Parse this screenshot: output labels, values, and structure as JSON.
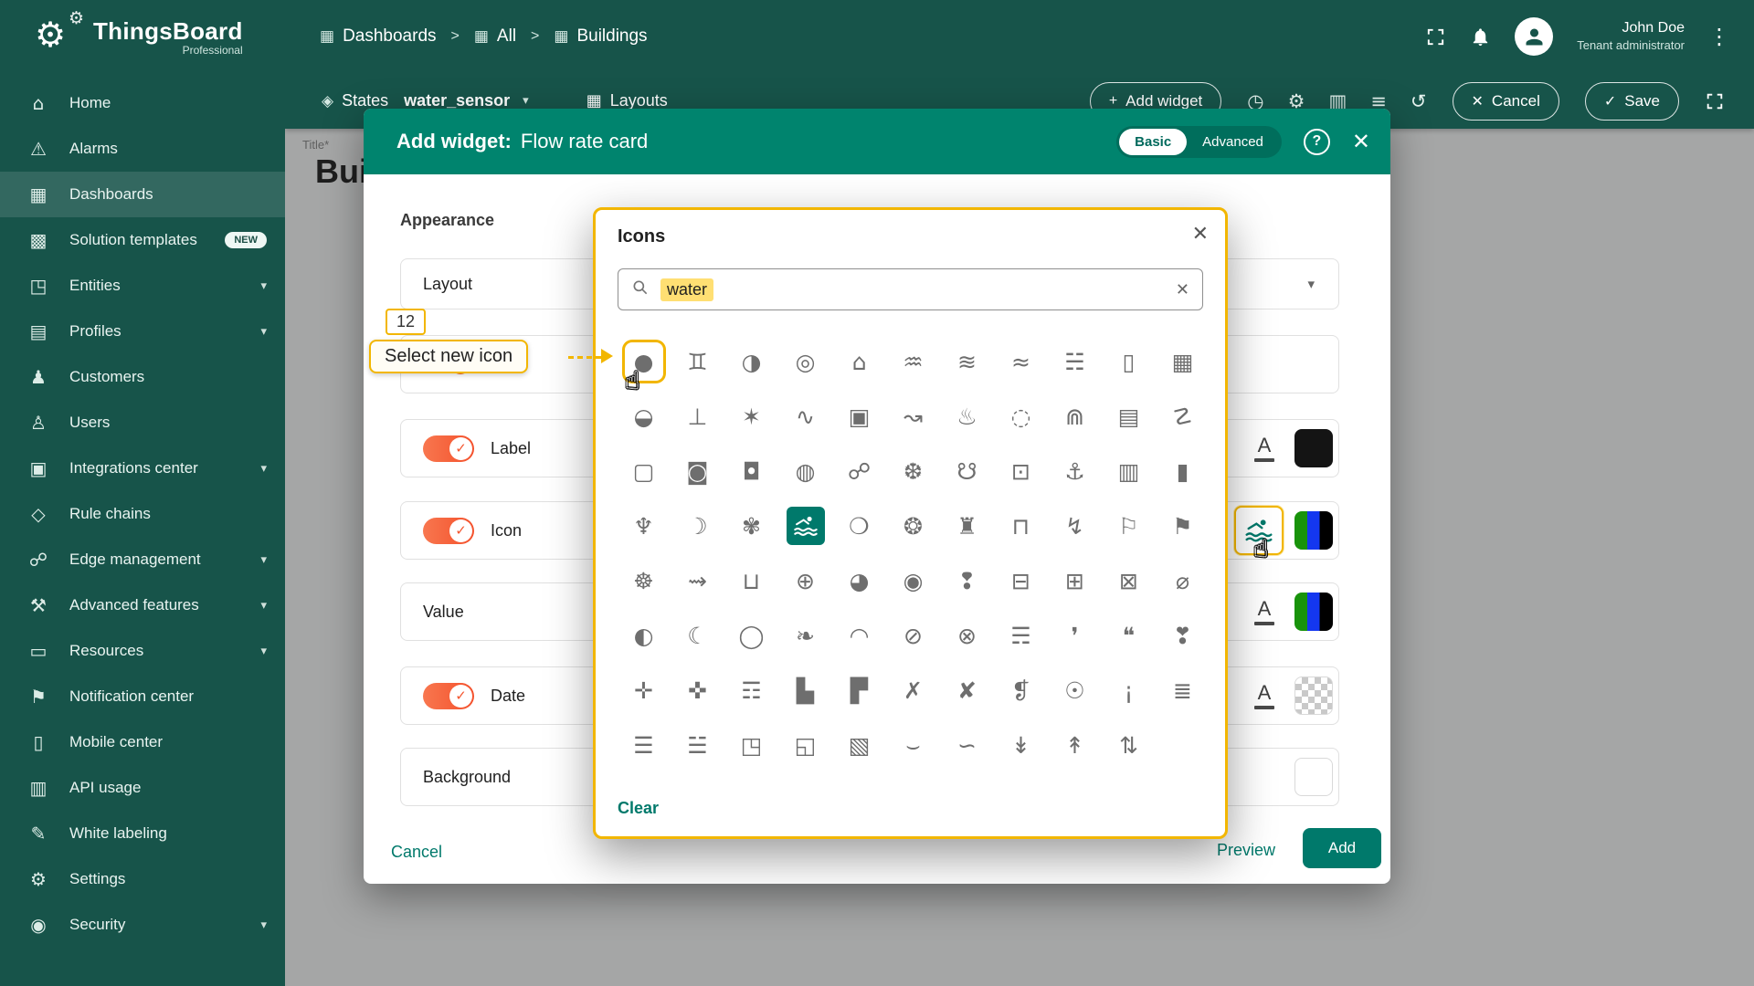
{
  "glyphs": {
    "chevron": "▾",
    "kebab": "⋮",
    "close": "✕",
    "check": "✓",
    "plus": "+",
    "separator": ">",
    "help": "?"
  },
  "colors": {
    "header": "#17544a",
    "modal_header": "#00846e",
    "accent_teal": "#00796b",
    "toggle_orange": "#f4562f",
    "annotation_amber": "#f2b600",
    "swatch_orange": "#f2682a",
    "label_swatch": "#141414"
  },
  "brand": {
    "name": "ThingsBoard",
    "sub": "Professional"
  },
  "header": {
    "breadcrumbs": [
      {
        "icon": "▦",
        "label": "Dashboards"
      },
      {
        "icon": "▦",
        "label": "All"
      },
      {
        "icon": "▦",
        "label": "Buildings"
      }
    ],
    "user": {
      "name": "John Doe",
      "role": "Tenant administrator"
    }
  },
  "sidebar": {
    "items": [
      {
        "label": "Home",
        "icon": "home-icon",
        "glyph": "⌂"
      },
      {
        "label": "Alarms",
        "icon": "alarms-icon",
        "glyph": "⚠"
      },
      {
        "label": "Dashboards",
        "icon": "dashboards-icon",
        "glyph": "▦",
        "active": true
      },
      {
        "label": "Solution templates",
        "icon": "solution-templates-icon",
        "glyph": "▩",
        "badge": "NEW"
      },
      {
        "label": "Entities",
        "icon": "entities-icon",
        "glyph": "◳",
        "chevron": true
      },
      {
        "label": "Profiles",
        "icon": "profiles-icon",
        "glyph": "▤",
        "chevron": true
      },
      {
        "label": "Customers",
        "icon": "customers-icon",
        "glyph": "♟"
      },
      {
        "label": "Users",
        "icon": "users-icon",
        "glyph": "♙"
      },
      {
        "label": "Integrations center",
        "icon": "integrations-icon",
        "glyph": "▣",
        "chevron": true
      },
      {
        "label": "Rule chains",
        "icon": "rule-chains-icon",
        "glyph": "◇"
      },
      {
        "label": "Edge management",
        "icon": "edge-management-icon",
        "glyph": "☍",
        "chevron": true
      },
      {
        "label": "Advanced features",
        "icon": "advanced-features-icon",
        "glyph": "⚒",
        "chevron": true
      },
      {
        "label": "Resources",
        "icon": "resources-icon",
        "glyph": "▭",
        "chevron": true
      },
      {
        "label": "Notification center",
        "icon": "notification-center-icon",
        "glyph": "⚑"
      },
      {
        "label": "Mobile center",
        "icon": "mobile-center-icon",
        "glyph": "▯"
      },
      {
        "label": "API usage",
        "icon": "api-usage-icon",
        "glyph": "▥"
      },
      {
        "label": "White labeling",
        "icon": "white-labeling-icon",
        "glyph": "✎"
      },
      {
        "label": "Settings",
        "icon": "settings-icon",
        "glyph": "⚙"
      },
      {
        "label": "Security",
        "icon": "security-icon",
        "glyph": "◉",
        "chevron": true
      }
    ]
  },
  "toolbar": {
    "states_icon": "◈",
    "states_label": "States",
    "state_value": "water_sensor",
    "layouts_icon": "▦",
    "layouts_label": "Layouts",
    "add_widget_label": "Add widget",
    "icon_buttons": [
      {
        "n": "time-window-icon",
        "g": "◷"
      },
      {
        "n": "dashboard-settings-icon",
        "g": "⚙"
      },
      {
        "n": "entity-aliases-icon",
        "g": "▥"
      },
      {
        "n": "filters-icon",
        "g": "≡"
      },
      {
        "n": "version-history-icon",
        "g": "↺"
      }
    ],
    "cancel_label": "Cancel",
    "save_label": "Save"
  },
  "content": {
    "title_label": "Title*",
    "title_value": "Bui"
  },
  "modal": {
    "title_prefix": "Add widget:",
    "title_name": "Flow rate card",
    "basic_label": "Basic",
    "advanced_label": "Advanced",
    "appearance_label": "Appearance",
    "fields": {
      "layout": "Layout",
      "label": "Label",
      "icon": "Icon",
      "value": "Value",
      "date": "Date",
      "background": "Background"
    },
    "cancel_label": "Cancel",
    "preview_label": "Preview",
    "add_label": "Add"
  },
  "icons_dialog": {
    "title": "Icons",
    "search_value": "water",
    "clear_label": "Clear",
    "selected_index": 36,
    "grid": [
      {
        "n": "water-drop",
        "g": "●"
      },
      {
        "n": "water-access",
        "g": "♊"
      },
      {
        "n": "water-contrast",
        "g": "◑"
      },
      {
        "n": "water-opacity",
        "g": "◎"
      },
      {
        "n": "water-fountain",
        "g": "⌂"
      },
      {
        "n": "tsunami",
        "g": "♒"
      },
      {
        "n": "waves",
        "g": "≋"
      },
      {
        "n": "water",
        "g": "≈"
      },
      {
        "n": "flood",
        "g": "☵"
      },
      {
        "n": "water-bottle",
        "g": "▯"
      },
      {
        "n": "water-photo",
        "g": "▦"
      },
      {
        "n": "water-up",
        "g": "◒"
      },
      {
        "n": "nordic-walking",
        "g": "⊥"
      },
      {
        "n": "waterfall-chart",
        "g": "✶"
      },
      {
        "n": "kayaking",
        "g": "∿"
      },
      {
        "n": "water-meter",
        "g": "▣"
      },
      {
        "n": "surfing",
        "g": "↝"
      },
      {
        "n": "hot-spring",
        "g": "♨"
      },
      {
        "n": "water-off",
        "g": "◌"
      },
      {
        "n": "house-flood",
        "g": "⋒"
      },
      {
        "n": "water-heater",
        "g": "▤"
      },
      {
        "n": "fishing",
        "g": "☡"
      },
      {
        "n": "water-frame",
        "g": "▢"
      },
      {
        "n": "shower-off",
        "g": "◙"
      },
      {
        "n": "water-jug",
        "g": "◘"
      },
      {
        "n": "whirlpool",
        "g": "◍"
      },
      {
        "n": "flood-house",
        "g": "☍"
      },
      {
        "n": "wave-swim",
        "g": "❆"
      },
      {
        "n": "water-thermo",
        "g": "☋"
      },
      {
        "n": "water-lock",
        "g": "⊡"
      },
      {
        "n": "anchor",
        "g": "⚓"
      },
      {
        "n": "water-analytics",
        "g": "▥"
      },
      {
        "n": "water-tank",
        "g": "▮"
      },
      {
        "n": "directions-boat",
        "g": "♆"
      },
      {
        "n": "water-melon",
        "g": "☽"
      },
      {
        "n": "water-park",
        "g": "✾"
      },
      {
        "n": "pool",
        "g": "≋"
      },
      {
        "n": "water-polo",
        "g": "❍"
      },
      {
        "n": "water-splash",
        "g": "❂"
      },
      {
        "n": "bridge",
        "g": "♜"
      },
      {
        "n": "pier",
        "g": "⊓"
      },
      {
        "n": "snorkeling",
        "g": "↯"
      },
      {
        "n": "sailing",
        "g": "⚐"
      },
      {
        "n": "water-ski",
        "g": "⚑"
      },
      {
        "n": "ship-wheel",
        "g": "☸"
      },
      {
        "n": "water-ski-jet",
        "g": "⇝"
      },
      {
        "n": "fire-truck",
        "g": "⊔"
      },
      {
        "n": "thermometer-water",
        "g": "⊕"
      },
      {
        "n": "water-drop-dark",
        "g": "◕"
      },
      {
        "n": "humidity-high",
        "g": "◉"
      },
      {
        "n": "humidity-alert",
        "g": "❢"
      },
      {
        "n": "water-pump",
        "g": "⊟"
      },
      {
        "n": "water-pump-meter",
        "g": "⊞"
      },
      {
        "n": "water-pumps",
        "g": "⊠"
      },
      {
        "n": "no-water-pump",
        "g": "⌀"
      },
      {
        "n": "water-loss",
        "g": "◐"
      },
      {
        "n": "water-drop-outline",
        "g": "☾"
      },
      {
        "n": "water-orb",
        "g": "◯"
      },
      {
        "n": "water-leaf",
        "g": "❧"
      },
      {
        "n": "water-arc",
        "g": "◠"
      },
      {
        "n": "leak-off",
        "g": "⊘"
      },
      {
        "n": "water-cross",
        "g": "⊗"
      },
      {
        "n": "moisture",
        "g": "☴"
      },
      {
        "n": "water-drop-small",
        "g": "❜"
      },
      {
        "n": "water-drops",
        "g": "❝"
      },
      {
        "n": "water-drop-exclaim",
        "g": "❣"
      },
      {
        "n": "water-add",
        "g": "✛"
      },
      {
        "n": "water-add-outline",
        "g": "✜"
      },
      {
        "n": "water-surface",
        "g": "☶"
      },
      {
        "n": "flood-building",
        "g": "▙"
      },
      {
        "n": "flood-off",
        "g": "▛"
      },
      {
        "n": "water-remove",
        "g": "✗"
      },
      {
        "n": "water-remove-outline",
        "g": "✘"
      },
      {
        "n": "water-flame",
        "g": "❡"
      },
      {
        "n": "water-sun",
        "g": "☉"
      },
      {
        "n": "water-exclaim",
        "g": "¡"
      },
      {
        "n": "water-dam",
        "g": "≣"
      },
      {
        "n": "dam",
        "g": "☰"
      },
      {
        "n": "water-dock",
        "g": "☱"
      },
      {
        "n": "water-cup",
        "g": "◳"
      },
      {
        "n": "water-cup-tilt",
        "g": "◱"
      },
      {
        "n": "water-image",
        "g": "▧"
      },
      {
        "n": "wave-low",
        "g": "⌣"
      },
      {
        "n": "wave-smooth",
        "g": "∽"
      },
      {
        "n": "water-level-down",
        "g": "↡"
      },
      {
        "n": "water-level-up",
        "g": "↟"
      },
      {
        "n": "water-level-full",
        "g": "⇅"
      }
    ]
  },
  "annotations": {
    "step_number": "12",
    "label": "Select new icon",
    "target_index": 0,
    "cursor_glyph": "☝"
  }
}
